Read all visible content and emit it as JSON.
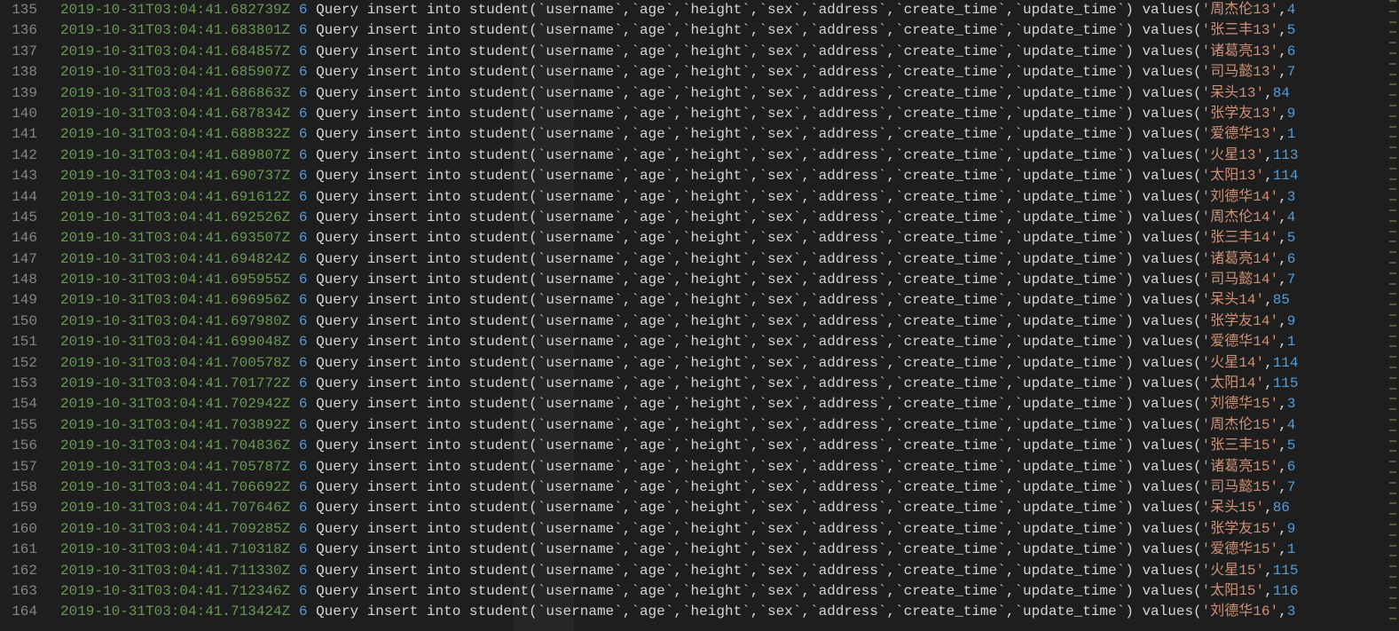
{
  "editor": {
    "highlight_column_text": "student",
    "lines": [
      {
        "ln": "135",
        "ts": "2019-10-31T03:04:41.682739Z",
        "id": "6",
        "name": "周杰伦13",
        "tail": "4"
      },
      {
        "ln": "136",
        "ts": "2019-10-31T03:04:41.683801Z",
        "id": "6",
        "name": "张三丰13",
        "tail": "5"
      },
      {
        "ln": "137",
        "ts": "2019-10-31T03:04:41.684857Z",
        "id": "6",
        "name": "诸葛亮13",
        "tail": "6"
      },
      {
        "ln": "138",
        "ts": "2019-10-31T03:04:41.685907Z",
        "id": "6",
        "name": "司马懿13",
        "tail": "7"
      },
      {
        "ln": "139",
        "ts": "2019-10-31T03:04:41.686863Z",
        "id": "6",
        "name": "呆头13",
        "tail": "84"
      },
      {
        "ln": "140",
        "ts": "2019-10-31T03:04:41.687834Z",
        "id": "6",
        "name": "张学友13",
        "tail": "9"
      },
      {
        "ln": "141",
        "ts": "2019-10-31T03:04:41.688832Z",
        "id": "6",
        "name": "爱德华13",
        "tail": "1"
      },
      {
        "ln": "142",
        "ts": "2019-10-31T03:04:41.689807Z",
        "id": "6",
        "name": "火星13",
        "tail": "113"
      },
      {
        "ln": "143",
        "ts": "2019-10-31T03:04:41.690737Z",
        "id": "6",
        "name": "太阳13",
        "tail": "114"
      },
      {
        "ln": "144",
        "ts": "2019-10-31T03:04:41.691612Z",
        "id": "6",
        "name": "刘德华14",
        "tail": "3"
      },
      {
        "ln": "145",
        "ts": "2019-10-31T03:04:41.692526Z",
        "id": "6",
        "name": "周杰伦14",
        "tail": "4"
      },
      {
        "ln": "146",
        "ts": "2019-10-31T03:04:41.693507Z",
        "id": "6",
        "name": "张三丰14",
        "tail": "5"
      },
      {
        "ln": "147",
        "ts": "2019-10-31T03:04:41.694824Z",
        "id": "6",
        "name": "诸葛亮14",
        "tail": "6"
      },
      {
        "ln": "148",
        "ts": "2019-10-31T03:04:41.695955Z",
        "id": "6",
        "name": "司马懿14",
        "tail": "7"
      },
      {
        "ln": "149",
        "ts": "2019-10-31T03:04:41.696956Z",
        "id": "6",
        "name": "呆头14",
        "tail": "85"
      },
      {
        "ln": "150",
        "ts": "2019-10-31T03:04:41.697980Z",
        "id": "6",
        "name": "张学友14",
        "tail": "9"
      },
      {
        "ln": "151",
        "ts": "2019-10-31T03:04:41.699048Z",
        "id": "6",
        "name": "爱德华14",
        "tail": "1"
      },
      {
        "ln": "152",
        "ts": "2019-10-31T03:04:41.700578Z",
        "id": "6",
        "name": "火星14",
        "tail": "114"
      },
      {
        "ln": "153",
        "ts": "2019-10-31T03:04:41.701772Z",
        "id": "6",
        "name": "太阳14",
        "tail": "115"
      },
      {
        "ln": "154",
        "ts": "2019-10-31T03:04:41.702942Z",
        "id": "6",
        "name": "刘德华15",
        "tail": "3"
      },
      {
        "ln": "155",
        "ts": "2019-10-31T03:04:41.703892Z",
        "id": "6",
        "name": "周杰伦15",
        "tail": "4"
      },
      {
        "ln": "156",
        "ts": "2019-10-31T03:04:41.704836Z",
        "id": "6",
        "name": "张三丰15",
        "tail": "5"
      },
      {
        "ln": "157",
        "ts": "2019-10-31T03:04:41.705787Z",
        "id": "6",
        "name": "诸葛亮15",
        "tail": "6"
      },
      {
        "ln": "158",
        "ts": "2019-10-31T03:04:41.706692Z",
        "id": "6",
        "name": "司马懿15",
        "tail": "7"
      },
      {
        "ln": "159",
        "ts": "2019-10-31T03:04:41.707646Z",
        "id": "6",
        "name": "呆头15",
        "tail": "86"
      },
      {
        "ln": "160",
        "ts": "2019-10-31T03:04:41.709285Z",
        "id": "6",
        "name": "张学友15",
        "tail": "9"
      },
      {
        "ln": "161",
        "ts": "2019-10-31T03:04:41.710318Z",
        "id": "6",
        "name": "爱德华15",
        "tail": "1"
      },
      {
        "ln": "162",
        "ts": "2019-10-31T03:04:41.711330Z",
        "id": "6",
        "name": "火星15",
        "tail": "115"
      },
      {
        "ln": "163",
        "ts": "2019-10-31T03:04:41.712346Z",
        "id": "6",
        "name": "太阳15",
        "tail": "116"
      },
      {
        "ln": "164",
        "ts": "2019-10-31T03:04:41.713424Z",
        "id": "6",
        "name": "刘德华16",
        "tail": "3"
      }
    ],
    "query_prefix": "Query insert into ",
    "table_name": "student",
    "columns_fragment": "(`username`,`age`,`height`,`sex`,`address`,`create_time`,`update_time`) values(",
    "colors": {
      "background": "#1e1e1e",
      "gutter": "#858585",
      "timestamp": "#6a9955",
      "number": "#569cd6",
      "string": "#ce9178",
      "default_text": "#d4d4d4"
    }
  }
}
